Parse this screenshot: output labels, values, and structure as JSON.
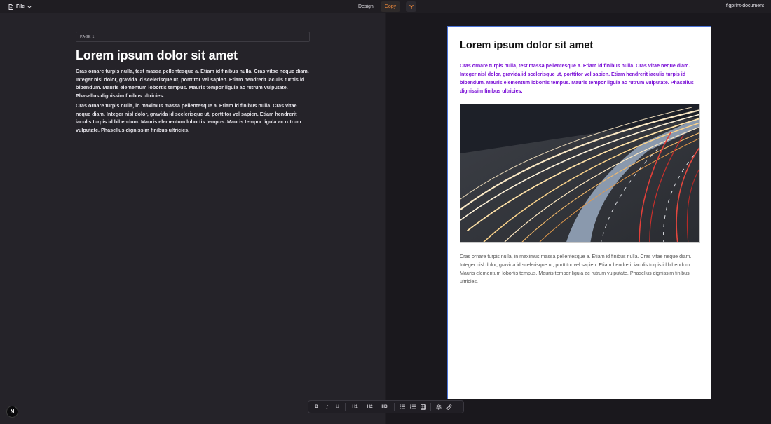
{
  "topbar": {
    "file_label": "File",
    "tabs": [
      {
        "label": "Design",
        "active": false
      },
      {
        "label": "Copy",
        "active": true
      }
    ],
    "document_name": "figprint-document"
  },
  "editor": {
    "page_label": "PAGE 1",
    "title": "Lorem ipsum dolor sit amet",
    "paragraphs": [
      "Cras ornare turpis nulla, test massa pellentesque a. Etiam id finibus nulla. Cras vitae neque diam. Integer nisl dolor, gravida id scelerisque ut, porttitor vel sapien. Etiam hendrerit iaculis turpis id bibendum. Mauris elementum lobortis tempus. Mauris tempor ligula ac rutrum vulputate. Phasellus dignissim finibus ultricies.",
      "Cras ornare turpis nulla, in maximus massa pellentesque a. Etiam id finibus nulla. Cras vitae neque diam. Integer nisl dolor, gravida id scelerisque ut, porttitor vel sapien. Etiam hendrerit iaculis turpis id bibendum. Mauris elementum lobortis tempus. Mauris tempor ligula ac rutrum vulputate. Phasellus dignissim finibus ultricies."
    ]
  },
  "preview": {
    "title": "Lorem ipsum dolor sit amet",
    "lead": "Cras ornare turpis nulla, test massa pellentesque a. Etiam id finibus nulla. Cras vitae neque diam. Integer nisl dolor, gravida id scelerisque ut, porttitor vel sapien. Etiam hendrerit iaculis turpis id bibendum. Mauris elementum lobortis tempus. Mauris tempor ligula ac rutrum vulputate. Phasellus dignissim finibus ultricies.",
    "image_subject": "long-exposure highway light trails at night",
    "body": "Cras ornare turpis nulla, in maximus massa pellentesque a. Etiam id finibus nulla. Cras vitae neque diam. Integer nisl dolor, gravida id scelerisque ut, porttitor vel sapien. Etiam hendrerit iaculis turpis id bibendum. Mauris elementum lobortis tempus. Mauris tempor ligula ac rutrum vulputate. Phasellus dignissim finibus ultricies."
  },
  "toolbar": {
    "bold": "B",
    "italic": "I",
    "underline": "U",
    "h1": "H1",
    "h2": "H2",
    "h3": "H3",
    "icons": [
      "bullet-list-icon",
      "numbered-list-icon",
      "table-icon",
      "layers-icon",
      "link-icon"
    ]
  },
  "badge": "N",
  "colors": {
    "accent": "#f08a3c",
    "lead_text": "#7a0fd6",
    "sheet_border": "#4b74d8",
    "app_background": "#1f1d22"
  }
}
